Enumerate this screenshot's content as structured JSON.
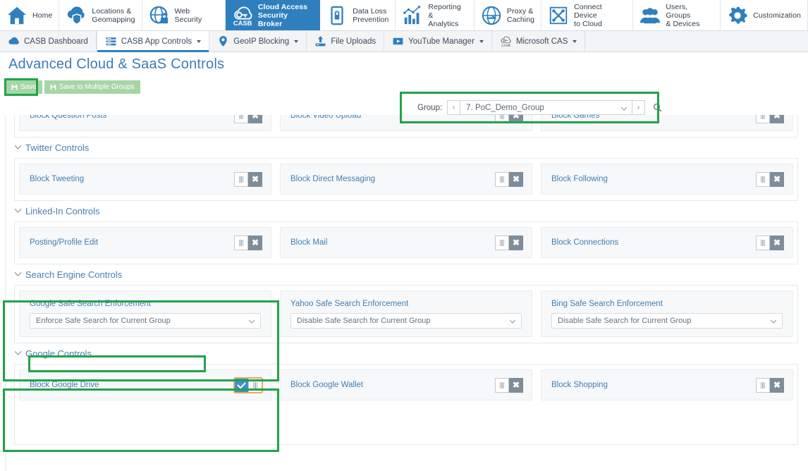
{
  "top_nav": {
    "items": [
      {
        "label": "Home",
        "icon": "home-icon",
        "active": false
      },
      {
        "label": "Locations &\nGeomapping",
        "icon": "cloud-shield-icon",
        "active": false
      },
      {
        "label": "Web Security",
        "icon": "globe-lock-icon",
        "active": false
      },
      {
        "label": "Cloud Access\nSecurity Broker",
        "icon": "casb-cloud-key-icon",
        "active": true
      },
      {
        "label": "Data Loss\nPrevention",
        "icon": "document-lock-icon",
        "active": false
      },
      {
        "label": "Reporting &\nAnalytics",
        "icon": "bar-chart-icon",
        "active": false
      },
      {
        "label": "Proxy &\nCaching",
        "icon": "globe-arrow-icon",
        "active": false
      },
      {
        "label": "Connect Device\nto Cloud",
        "icon": "connect-cross-icon",
        "active": false
      },
      {
        "label": "Users, Groups\n& Devices",
        "icon": "users-icon",
        "active": false
      },
      {
        "label": "Customization",
        "icon": "gears-icon",
        "active": false
      }
    ],
    "active_color": "#2f7fbf"
  },
  "sub_nav": {
    "items": [
      {
        "label": "CASB Dashboard",
        "icon": "cloud-icon",
        "caret": false,
        "active": false
      },
      {
        "label": "CASB App Controls",
        "icon": "list-rows-icon",
        "caret": true,
        "active": true
      },
      {
        "label": "GeoIP Blocking",
        "icon": "location-pin-icon",
        "caret": true,
        "active": false
      },
      {
        "label": "File Uploads",
        "icon": "upload-icon",
        "caret": false,
        "active": false
      },
      {
        "label": "YouTube Manager",
        "icon": "video-play-icon",
        "caret": true,
        "active": false
      },
      {
        "label": "Microsoft CAS",
        "icon": "casb-cloud-icon",
        "caret": true,
        "active": false
      }
    ]
  },
  "page": {
    "title": "Advanced Cloud & SaaS Controls"
  },
  "toolbar": {
    "save_label": "Save",
    "save_multiple_label": "Save to Multiple Groups",
    "button_color": "#a6d6a6"
  },
  "group_selector": {
    "label": "Group:",
    "prev_label": "‹",
    "next_label": "›",
    "value": "7. PoC_Demo_Group",
    "search_icon": "search-icon"
  },
  "highlight_color": "#22a34a",
  "sections": [
    {
      "title": null,
      "partial_top": true,
      "rows": [
        [
          {
            "label": "Block Question Posts",
            "type": "toggle",
            "state": "off"
          },
          {
            "label": "Block Video Upload",
            "type": "toggle",
            "state": "off"
          },
          {
            "label": "Block Games",
            "type": "toggle",
            "state": "off"
          }
        ]
      ]
    },
    {
      "title": "Twitter Controls",
      "rows": [
        [
          {
            "label": "Block Tweeting",
            "type": "toggle",
            "state": "off"
          },
          {
            "label": "Block Direct Messaging",
            "type": "toggle",
            "state": "off"
          },
          {
            "label": "Block Following",
            "type": "toggle",
            "state": "off"
          }
        ]
      ]
    },
    {
      "title": "Linked-In Controls",
      "rows": [
        [
          {
            "label": "Posting/Profile Edit",
            "type": "toggle",
            "state": "off"
          },
          {
            "label": "Block Mail",
            "type": "toggle",
            "state": "off"
          },
          {
            "label": "Block Connections",
            "type": "toggle",
            "state": "off"
          }
        ]
      ]
    },
    {
      "title": "Search Engine Controls",
      "highlight_section": true,
      "rows": [
        [
          {
            "label": "Google Safe Search Enforcement",
            "type": "select",
            "value": "Enforce Safe Search for Current Group",
            "highlight": true
          },
          {
            "label": "Yahoo Safe Search Enforcement",
            "type": "select",
            "value": "Disable Safe Search for Current Group"
          },
          {
            "label": "Bing Safe Search Enforcement",
            "type": "select",
            "value": "Disable Safe Search for Current Group"
          }
        ]
      ]
    },
    {
      "title": "Google Controls",
      "highlight_section": true,
      "rows": [
        [
          {
            "label": "Block Google Drive",
            "type": "toggle",
            "state": "on"
          },
          {
            "label": "Block Google Wallet",
            "type": "toggle",
            "state": "off"
          },
          {
            "label": "Block Shopping",
            "type": "toggle",
            "state": "off"
          }
        ],
        [
          {
            "label": "",
            "type": "blank"
          },
          {
            "label": "",
            "type": "blank"
          },
          {
            "label": "",
            "type": "blank"
          }
        ]
      ]
    }
  ]
}
